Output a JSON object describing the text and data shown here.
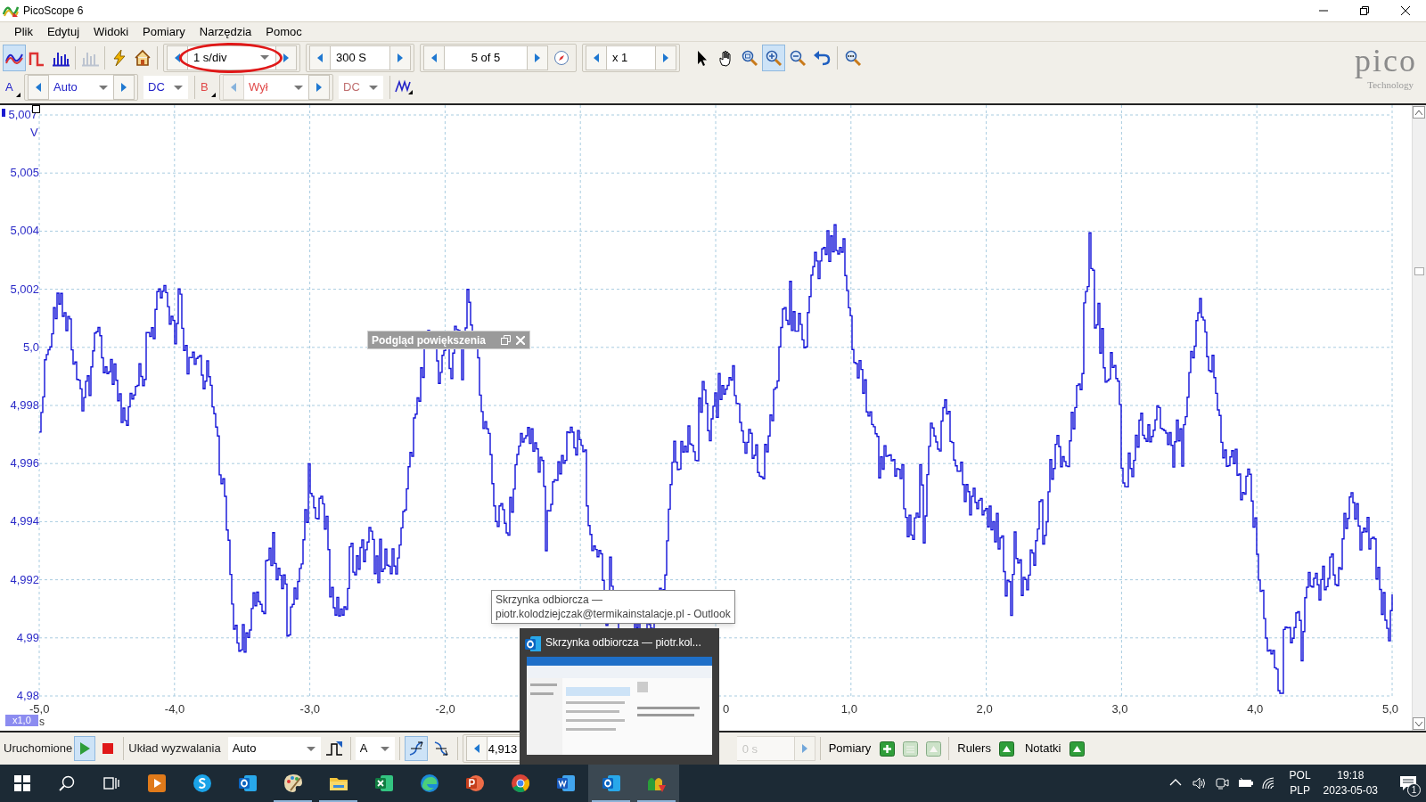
{
  "window": {
    "title": "PicoScope 6"
  },
  "menu": [
    {
      "label": "Plik"
    },
    {
      "label": "Edytuj"
    },
    {
      "label": "Widoki"
    },
    {
      "label": "Pomiary"
    },
    {
      "label": "Narzędzia"
    },
    {
      "label": "Pomoc"
    }
  ],
  "modes": [
    {
      "kind": "scope",
      "selected": true
    },
    {
      "kind": "persistence",
      "selected": false
    },
    {
      "kind": "spectrum",
      "selected": false
    },
    {
      "kind": "xy",
      "selected": false,
      "disabled": true
    }
  ],
  "toolbar": {
    "timebase": "1 s/div",
    "samples": "300 S",
    "buffer": "5 of 5",
    "zoom": "x 1"
  },
  "tools": [
    {
      "kind": "pointer",
      "selected": false
    },
    {
      "kind": "hand",
      "selected": false
    },
    {
      "kind": "zoom-area",
      "selected": false
    },
    {
      "kind": "zoom-in",
      "selected": true
    },
    {
      "kind": "zoom-out",
      "selected": false
    },
    {
      "kind": "undo",
      "selected": false
    }
  ],
  "logo": {
    "name": "pico",
    "subtitle": "Technology"
  },
  "channels": [
    {
      "label": "A",
      "range": "Auto",
      "coupling": "DC",
      "color": "#2323c8",
      "enabled": true
    },
    {
      "label": "B",
      "range": "Wył",
      "coupling": "DC",
      "color": "#e04848",
      "enabled": false
    }
  ],
  "plot": {
    "y_unit": "V",
    "y_labels": [
      "5,007",
      "5,005",
      "5,004",
      "5,002",
      "5,0",
      "4,998",
      "4,996",
      "4,994",
      "4,992",
      "4,99",
      "4,98"
    ],
    "x_labels": [
      "-5,0",
      "-4,0",
      "-3,0",
      "-2,0",
      "0",
      "1,0",
      "2,0",
      "3,0",
      "4,0",
      "5,0"
    ],
    "x_unit": "s",
    "scale_badge": "x1,0"
  },
  "zoom_overview": {
    "title": "Podgląd powiększenia"
  },
  "trigger_bar": {
    "status": "Uruchomione",
    "trigger_label": "Układ wyzwalania",
    "mode": "Auto",
    "source": "A",
    "threshold": "4,913",
    "delay": "0 s",
    "edges": [
      {
        "kind": "rising",
        "selected": true
      },
      {
        "kind": "falling",
        "selected": false
      }
    ],
    "measurements_label": "Pomiary",
    "rulers_label": "Rulers",
    "notes_label": "Notatki"
  },
  "tooltip": {
    "lines": [
      "Skrzynka odbiorcza —",
      "piotr.kolodziejczak@termikainstalacje.pl - Outlook"
    ]
  },
  "taskbar_preview": {
    "title": "Skrzynka odbiorcza — piotr.kol..."
  },
  "taskbar": {
    "apps": [
      {
        "kind": "media",
        "running": false,
        "highlighted": false
      },
      {
        "kind": "skype",
        "running": false,
        "highlighted": false
      },
      {
        "kind": "outlook",
        "running": false,
        "highlighted": false
      },
      {
        "kind": "paint",
        "running": true,
        "highlighted": false
      },
      {
        "kind": "explorer",
        "running": true,
        "highlighted": false
      },
      {
        "kind": "excel",
        "running": false,
        "highlighted": false
      },
      {
        "kind": "edge",
        "running": false,
        "highlighted": false
      },
      {
        "kind": "powerpoint",
        "running": false,
        "highlighted": false
      },
      {
        "kind": "chrome",
        "running": false,
        "highlighted": false
      },
      {
        "kind": "word",
        "running": false,
        "highlighted": false
      },
      {
        "kind": "outlook",
        "running": true,
        "highlighted": true
      },
      {
        "kind": "picoscope",
        "running": true,
        "highlighted": true
      }
    ],
    "tray": {
      "lang": "POL",
      "layout": "PLP",
      "time": "19:18",
      "date": "2023-05-03",
      "notifications": "1"
    }
  }
}
